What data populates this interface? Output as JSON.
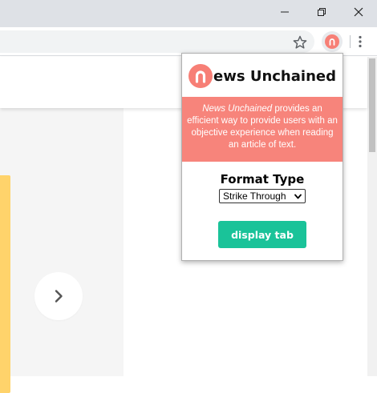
{
  "window": {
    "controls": {
      "minimize_icon": "minimize-icon",
      "maximize_icon": "restore-icon",
      "close_icon": "close-icon"
    }
  },
  "toolbar": {
    "bookmark_icon": "star-icon",
    "extension_icon": "news-unchained-extension-icon",
    "menu_icon": "kebab-menu-icon"
  },
  "page": {
    "next_icon": "chevron-right-icon"
  },
  "popup": {
    "brand": {
      "logo_letter": "n",
      "name": "ews Unchained"
    },
    "banner": {
      "italic": "News Unchained",
      "text": " provides an efficient way to provide users with an objective experience when reading an article of text."
    },
    "format_label": "Format Type",
    "format_select": {
      "selected": "Strike Through"
    },
    "display_button": "display tab"
  },
  "colors": {
    "accent": "#f77f76",
    "banner_bg": "#f7847b",
    "button_bg": "#1ac399",
    "yellow_bar": "#ffd36b"
  }
}
